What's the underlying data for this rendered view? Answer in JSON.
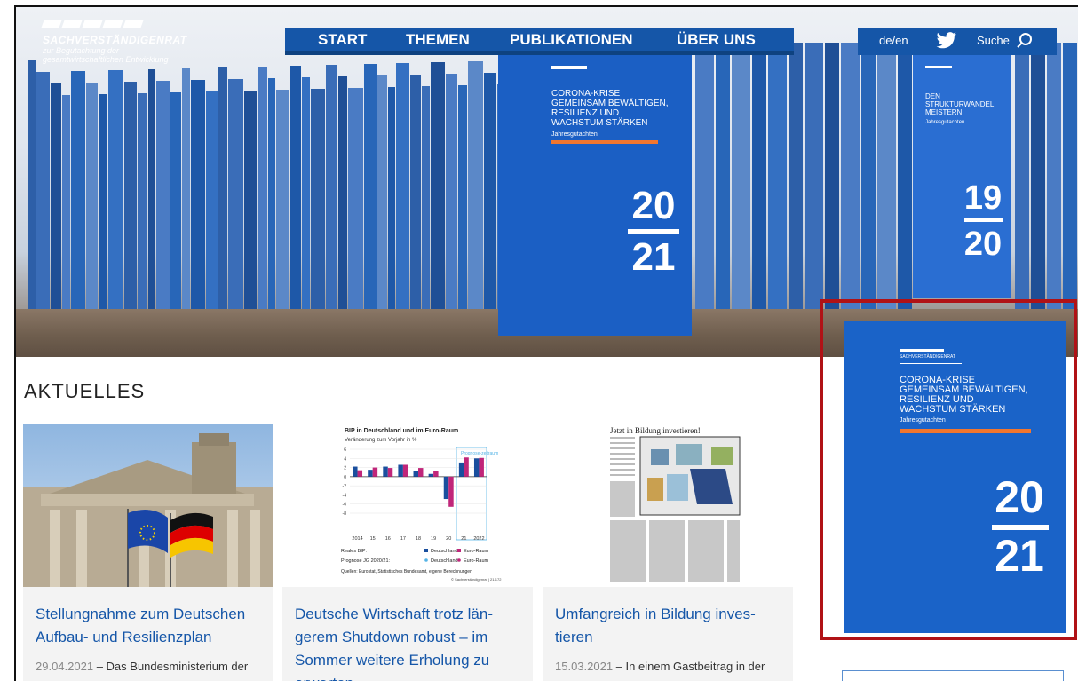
{
  "header": {
    "logo": {
      "title": "SACHVERSTÄNDIGENRAT",
      "subtitle_line1": "zur Begutachtung der",
      "subtitle_line2": "gesamtwirtschaftlichen Entwicklung"
    },
    "nav": [
      "START",
      "THEMEN",
      "PUBLIKATIONEN",
      "ÜBER UNS"
    ],
    "lang": {
      "de": "de",
      "sep": "/",
      "en": "en"
    },
    "search_label": "Suche",
    "icons": {
      "social": "twitter-icon",
      "search": "search-icon"
    }
  },
  "hero": {
    "book_main": {
      "title_line1": "CORONA-KRISE",
      "title_line2": "GEMEINSAM BEWÄLTIGEN,",
      "title_line3": "RESILIENZ UND",
      "title_line4": "WACHSTUM STÄRKEN",
      "subtitle": "Jahresgutachten",
      "year_top": "20",
      "year_bottom": "21"
    },
    "book_right": {
      "title_line1": "DEN STRUKTURWANDEL",
      "title_line2": "MEISTERN",
      "subtitle": "Jahresgutachten",
      "year_top": "19",
      "year_bottom": "20"
    }
  },
  "aktuelles": {
    "title": "AKTUELLES",
    "cards": [
      {
        "title": "Stellungnahme zum Deutschen Aufbau- und Resilienzplan",
        "date": "29.04.2021",
        "teaser": "– Das Bundesministerium der"
      },
      {
        "title": "Deutsche Wirtschaft trotz län­gerem Shutdown robust – im Sommer weitere Erholung zu erwarten",
        "chart_title": "BIP in Deutschland und im Euro-Raum",
        "chart_subtitle": "Veränderung zum Vorjahr in %",
        "prognose_label": "Prognose-zeitraum",
        "x_labels": [
          "2014",
          "15",
          "16",
          "17",
          "18",
          "19",
          "20",
          "21",
          "2022"
        ],
        "y_labels": [
          "6",
          "4",
          "2",
          "0",
          "-2",
          "-4",
          "-6",
          "-8"
        ],
        "legend_row1_label": "Reales BIP:",
        "legend_row2_label": "Prognose JG 2020/21:",
        "legend_de": "Deutschland",
        "legend_eu": "Euro-Raum",
        "source": "Quellen: Eurostat, Statistisches Bundesamt, eigene Berechnungen",
        "copyright": "© Sachverständigenrat | 21-172"
      },
      {
        "title": "Umfangreich in Bildung inves­tieren",
        "newspaper_headline": "Jetzt in Bildung investieren!",
        "date": "15.03.2021",
        "teaser": "– In einem Gastbeitrag in der"
      }
    ]
  },
  "sidebar": {
    "cover": {
      "org": "SACHVERSTÄNDIGENRAT",
      "title_line1": "CORONA-KRISE",
      "title_line2": "GEMEINSAM BEWÄLTIGEN,",
      "title_line3": "RESILIENZ UND",
      "title_line4": "WACHSTUM STÄRKEN",
      "subtitle": "Jahresgutachten",
      "year_top": "20",
      "year_bottom": "21"
    },
    "highlight_color": "#b01216"
  },
  "chart_data": {
    "type": "bar",
    "title": "BIP in Deutschland und im Euro-Raum",
    "subtitle": "Veränderung zum Vorjahr in %",
    "categories": [
      "2014",
      "15",
      "16",
      "17",
      "18",
      "19",
      "20",
      "21",
      "2022"
    ],
    "ylim": [
      -8,
      6
    ],
    "series": [
      {
        "name": "Deutschland",
        "color": "#1a4f9e",
        "values": [
          2.2,
          1.5,
          2.2,
          2.6,
          1.3,
          0.6,
          -4.9,
          3.1,
          4.0
        ]
      },
      {
        "name": "Euro-Raum",
        "color": "#c0267a",
        "values": [
          1.4,
          2.0,
          1.9,
          2.6,
          1.9,
          1.3,
          -6.6,
          4.2,
          4.1
        ]
      }
    ]
  },
  "colors": {
    "brand_blue": "#1556a8",
    "link_blue": "#1556a8",
    "accent_orange": "#f2762e",
    "highlight_red": "#b01216"
  }
}
